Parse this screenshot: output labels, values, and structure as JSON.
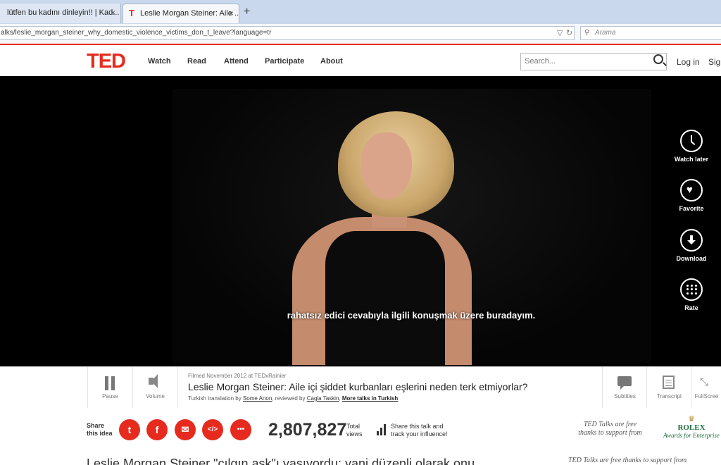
{
  "browser": {
    "tabs": [
      {
        "title": "lütfen bu kadını dinleyin!! | Kad..."
      },
      {
        "title": "Leslie Morgan Steiner: Aile ..."
      }
    ],
    "close_glyph": "×",
    "new_tab_glyph": "+",
    "url": "alks/leslie_morgan_steiner_why_domestic_violence_victims_don_t_leave?language=tr",
    "search_placeholder": "Arama"
  },
  "header": {
    "logo": "TED",
    "nav": [
      "Watch",
      "Read",
      "Attend",
      "Participate",
      "About"
    ],
    "search_placeholder": "Search...",
    "login": "Log in",
    "signup": "Sig"
  },
  "video": {
    "subtitle": "rahatsız edici cevabıyla ilgili konuşmak üzere buradayım.",
    "side_actions": [
      {
        "label": "Watch later",
        "icon": "clock-icon"
      },
      {
        "label": "Favorite",
        "icon": "heart-icon"
      },
      {
        "label": "Download",
        "icon": "download-icon"
      },
      {
        "label": "Rate",
        "icon": "dots-icon"
      }
    ]
  },
  "controls": {
    "pause": "Pause",
    "volume": "Volume",
    "filmed": "Filmed November 2012 at TEDxRainier",
    "title": "Leslie Morgan Steiner: Aile içi şiddet kurbanları eşlerini neden terk etmiyorlar?",
    "translation_prefix": "Turkish translation by",
    "translator": "Some Anon",
    "reviewed_prefix": ", reviewed by",
    "reviewer": "Cagla Taskin",
    "more": "More talks in Turkish",
    "subtitles": "Subtitles",
    "transcript": "Transcript",
    "fullscreen": "FullScree"
  },
  "share": {
    "label_line1": "Share",
    "label_line2": "this idea",
    "buttons": [
      {
        "icon": "twitter-icon",
        "glyph": "t"
      },
      {
        "icon": "facebook-icon",
        "glyph": "f"
      },
      {
        "icon": "email-icon",
        "glyph": "✉"
      },
      {
        "icon": "embed-icon",
        "glyph": "</>"
      },
      {
        "icon": "more-icon",
        "glyph": "•••"
      }
    ],
    "views": "2,807,827",
    "views_label_1": "Total",
    "views_label_2": "views",
    "track_1": "Share this talk and",
    "track_2": "track your influence!",
    "sponsor_1": "TED Talks are free",
    "sponsor_2": "thanks to support from",
    "rolex_crown": "♛",
    "rolex_name": "ROLEX",
    "rolex_award": "Awards for Enterprise"
  },
  "bottom": {
    "title": "Leslie Morgan Steiner \"çılgın aşk\"ı yaşıyordu; yani düzenli olarak onu",
    "sponsor": "TED Talks are free thanks to support from"
  },
  "colors": {
    "accent": "#e62b1e"
  }
}
